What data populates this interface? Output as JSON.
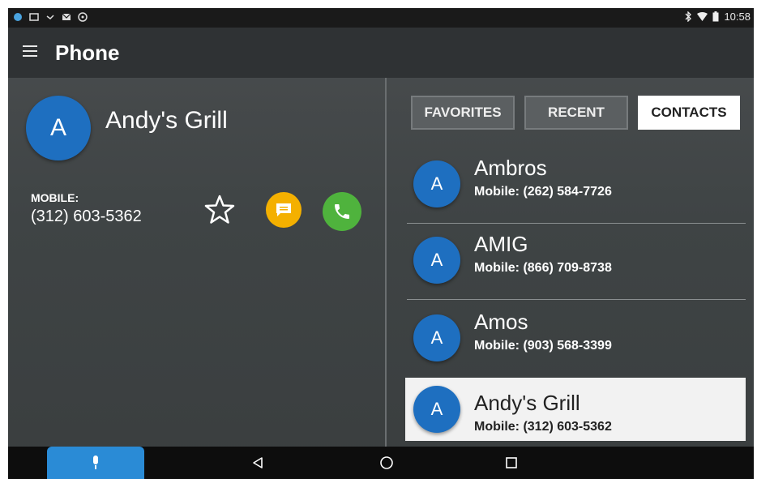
{
  "status_bar": {
    "time": "10:58"
  },
  "app_bar": {
    "title": "Phone"
  },
  "detail": {
    "avatar_letter": "A",
    "name": "Andy's Grill",
    "phone_label": "MOBILE:",
    "phone_number": "(312) 603-5362"
  },
  "tabs": [
    {
      "label": "FAVORITES"
    },
    {
      "label": "RECENT"
    },
    {
      "label": "CONTACTS",
      "selected": true
    }
  ],
  "contacts": [
    {
      "letter": "A",
      "name": "Ambros",
      "phone": "Mobile:  (262) 584-7726"
    },
    {
      "letter": "A",
      "name": "AMIG",
      "phone": "Mobile:  (866) 709-8738"
    },
    {
      "letter": "A",
      "name": "Amos",
      "phone": "Mobile:  (903) 568-3399"
    },
    {
      "letter": "A",
      "name": "Andy's Grill",
      "phone": "Mobile:  (312) 603-5362",
      "selected": true
    }
  ],
  "colors": {
    "avatar": "#1e6fc0",
    "message": "#f4b000",
    "call": "#4fb33d",
    "mic_tab": "#2a8bd6"
  }
}
